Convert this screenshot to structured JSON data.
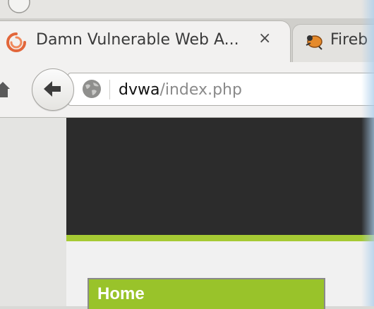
{
  "browser": {
    "tabs": [
      {
        "title": "Damn Vulnerable Web A...",
        "active": true,
        "favicon": "dvwa-swirl-icon"
      },
      {
        "title": "Fireb",
        "active": false,
        "favicon": "firebug-icon"
      }
    ],
    "close_icon": "×",
    "url": {
      "host": "dvwa",
      "path": "/index.php"
    }
  },
  "page": {
    "header_color": "#2c2c2c",
    "accent_color": "#a6ca34",
    "menu": [
      {
        "label": "Home",
        "active": true
      }
    ]
  }
}
